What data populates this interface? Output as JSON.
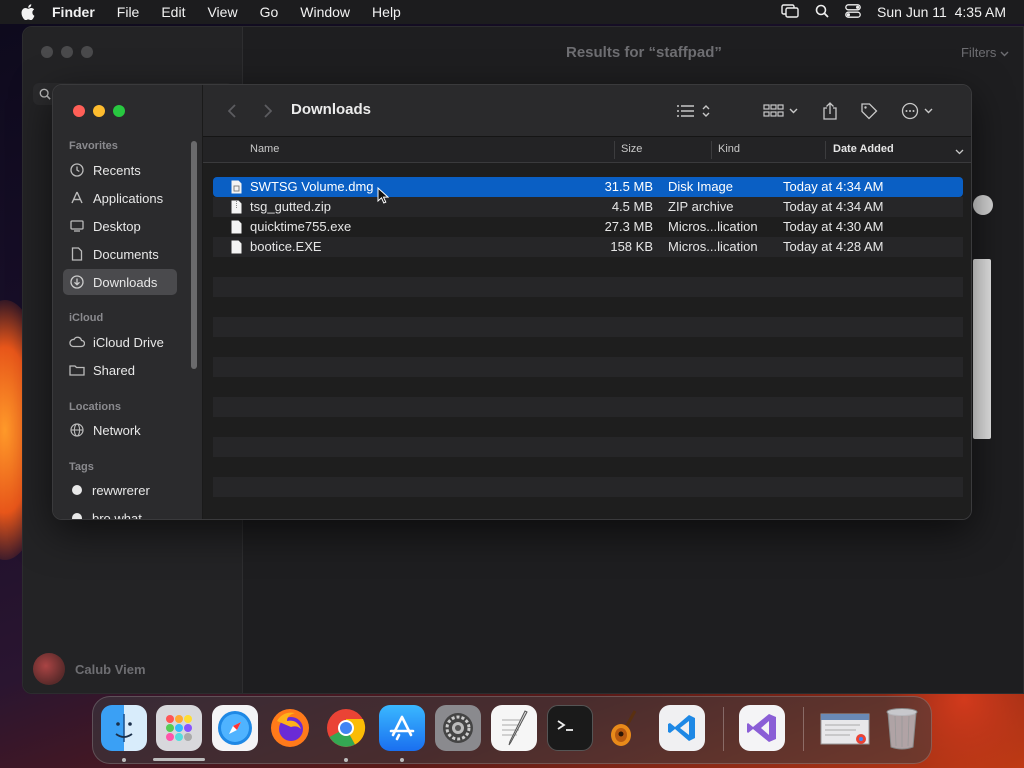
{
  "menubar": {
    "app_name": "Finder",
    "items": [
      "File",
      "Edit",
      "View",
      "Go",
      "Window",
      "Help"
    ],
    "clock": "Sun Jun 11  4:35 AM"
  },
  "background_window": {
    "title": "Results for “staffpad”",
    "filters_label": "Filters",
    "user_name": "Calub Viem"
  },
  "finder": {
    "title": "Downloads",
    "sidebar": {
      "favorites_label": "Favorites",
      "favorites": [
        "Recents",
        "Applications",
        "Desktop",
        "Documents",
        "Downloads"
      ],
      "icloud_label": "iCloud",
      "icloud": [
        "iCloud Drive",
        "Shared"
      ],
      "locations_label": "Locations",
      "locations": [
        "Network"
      ],
      "tags_label": "Tags",
      "tags": [
        "rewwrerer",
        "bro what"
      ]
    },
    "columns": {
      "name": "Name",
      "size": "Size",
      "kind": "Kind",
      "date_added": "Date Added"
    },
    "files": [
      {
        "name": "SWTSG Volume.dmg",
        "size": "31.5 MB",
        "kind": "Disk Image",
        "date": "Today at 4:34 AM"
      },
      {
        "name": "tsg_gutted.zip",
        "size": "4.5 MB",
        "kind": "ZIP archive",
        "date": "Today at 4:34 AM"
      },
      {
        "name": "quicktime755.exe",
        "size": "27.3 MB",
        "kind": "Micros...lication",
        "date": "Today at 4:30 AM"
      },
      {
        "name": "bootice.EXE",
        "size": "158 KB",
        "kind": "Micros...lication",
        "date": "Today at 4:28 AM"
      }
    ],
    "selected_index": 0
  },
  "dock": {
    "apps": [
      "finder-icon",
      "launchpad-icon",
      "safari-icon",
      "firefox-icon",
      "chrome-icon",
      "app-store-icon",
      "system-settings-icon",
      "textedit-icon",
      "terminal-icon",
      "garageband-icon",
      "vscode-icon",
      "visual-studio-icon",
      "chrome-window-icon",
      "trash-icon"
    ]
  },
  "colors": {
    "selection": "#0a5fc4",
    "close": "#ff5f57",
    "minimize": "#febc2e",
    "maximize": "#28c840"
  }
}
